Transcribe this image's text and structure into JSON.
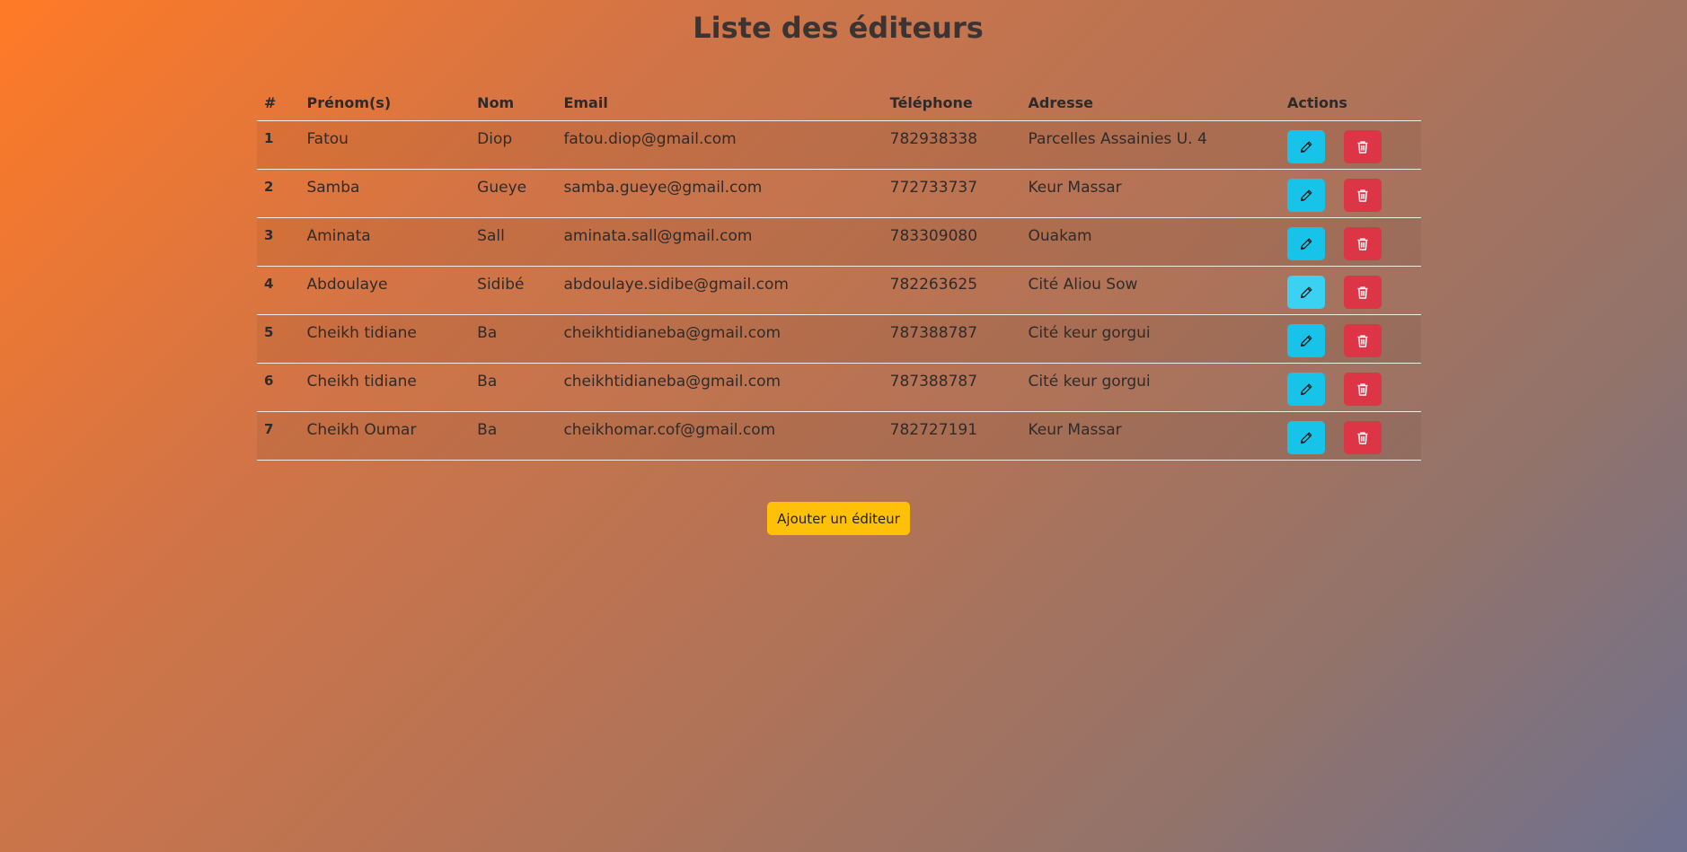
{
  "page": {
    "title": "Liste des éditeurs"
  },
  "table": {
    "headers": {
      "index": "#",
      "first_name": "Prénom(s)",
      "last_name": "Nom",
      "email": "Email",
      "phone": "Téléphone",
      "address": "Adresse",
      "actions": "Actions"
    },
    "rows": [
      {
        "index": "1",
        "first_name": "Fatou",
        "last_name": "Diop",
        "email": "fatou.diop@gmail.com",
        "phone": "782938338",
        "address": "Parcelles Assainies U. 4"
      },
      {
        "index": "2",
        "first_name": "Samba",
        "last_name": "Gueye",
        "email": "samba.gueye@gmail.com",
        "phone": "772733737",
        "address": "Keur Massar"
      },
      {
        "index": "3",
        "first_name": "Aminata",
        "last_name": "Sall",
        "email": "aminata.sall@gmail.com",
        "phone": "783309080",
        "address": "Ouakam"
      },
      {
        "index": "4",
        "first_name": "Abdoulaye",
        "last_name": "Sidibé",
        "email": "abdoulaye.sidibe@gmail.com",
        "phone": "782263625",
        "address": "Cité Aliou Sow"
      },
      {
        "index": "5",
        "first_name": "Cheikh tidiane",
        "last_name": "Ba",
        "email": "cheikhtidianeba@gmail.com",
        "phone": "787388787",
        "address": "Cité keur gorgui"
      },
      {
        "index": "6",
        "first_name": "Cheikh tidiane",
        "last_name": "Ba",
        "email": "cheikhtidianeba@gmail.com",
        "phone": "787388787",
        "address": "Cité keur gorgui"
      },
      {
        "index": "7",
        "first_name": "Cheikh Oumar",
        "last_name": "Ba",
        "email": "cheikhomar.cof@gmail.com",
        "phone": "782727191",
        "address": "Keur Massar"
      }
    ],
    "row_actions": {
      "edit_icon": "pencil-icon",
      "delete_icon": "trash-icon"
    }
  },
  "add_button": {
    "label": "Ajouter un éditeur"
  },
  "colors": {
    "edit_button": "#17c3e8",
    "delete_button": "#dc3545",
    "add_button": "#ffc107",
    "background_start": "#ff7a26",
    "background_end": "#6e7190"
  }
}
